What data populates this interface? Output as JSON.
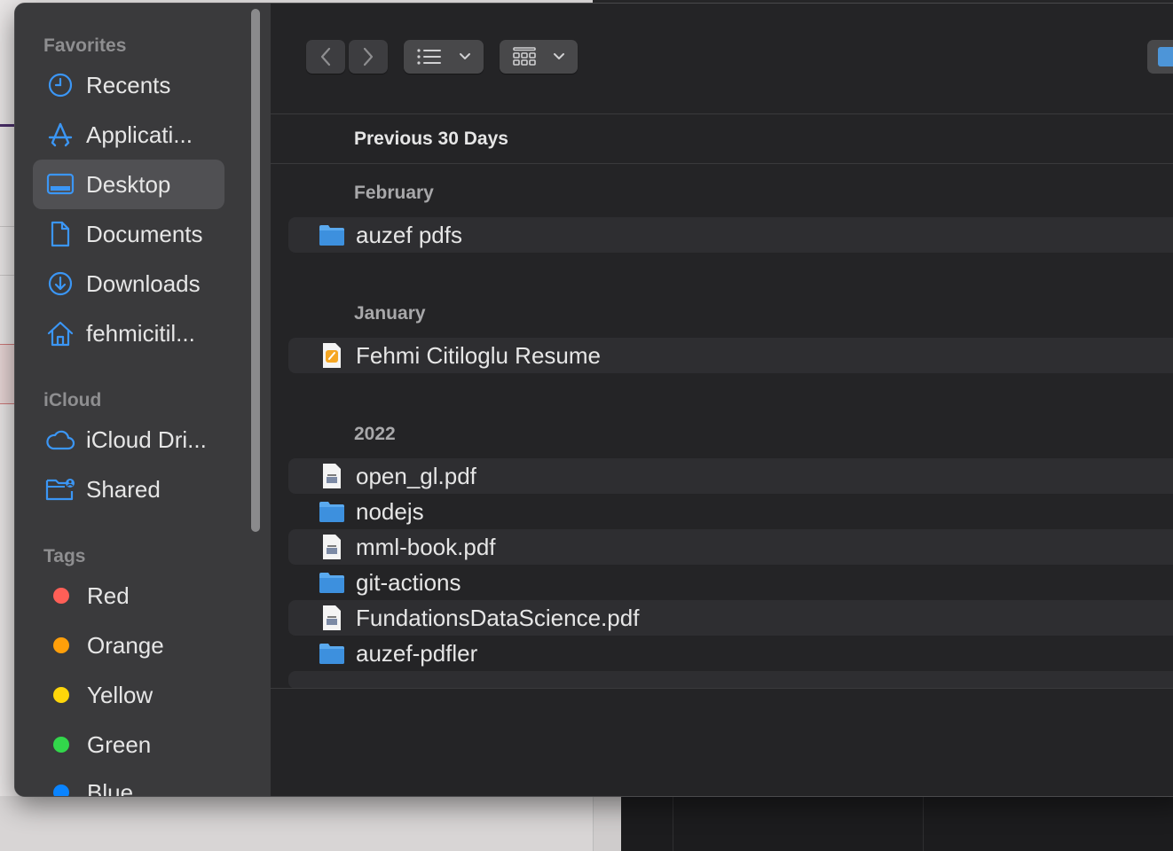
{
  "sidebar": {
    "favorites_title": "Favorites",
    "favorites": [
      {
        "label": "Recents",
        "icon": "clock-icon"
      },
      {
        "label": "Applicati...",
        "icon": "applications-icon"
      },
      {
        "label": "Desktop",
        "icon": "desktop-icon",
        "selected": true
      },
      {
        "label": "Documents",
        "icon": "document-icon"
      },
      {
        "label": "Downloads",
        "icon": "download-icon"
      },
      {
        "label": "fehmicitil...",
        "icon": "home-icon"
      }
    ],
    "icloud_title": "iCloud",
    "icloud": [
      {
        "label": "iCloud Dri...",
        "icon": "cloud-icon"
      },
      {
        "label": "Shared",
        "icon": "shared-folder-icon"
      }
    ],
    "tags_title": "Tags",
    "tags": [
      {
        "label": "Red",
        "color": "#ff5f57"
      },
      {
        "label": "Orange",
        "color": "#ff9f0a"
      },
      {
        "label": "Yellow",
        "color": "#ffd60a"
      },
      {
        "label": "Green",
        "color": "#32d74b"
      },
      {
        "label": "Blue",
        "color": "#0a84ff"
      }
    ]
  },
  "toolbar": {
    "back": "chevron-left-icon",
    "forward": "chevron-right-icon",
    "view": "list-view-icon",
    "group": "grid-group-icon"
  },
  "main": {
    "group_title": "Previous 30 Days",
    "sections": [
      {
        "title": "February",
        "items": [
          {
            "name": "auzef pdfs",
            "type": "folder"
          }
        ]
      },
      {
        "title": "January",
        "items": [
          {
            "name": "Fehmi Citiloglu Resume",
            "type": "pages"
          }
        ]
      },
      {
        "title": "2022",
        "items": [
          {
            "name": "open_gl.pdf",
            "type": "pdf"
          },
          {
            "name": "nodejs",
            "type": "folder"
          },
          {
            "name": "mml-book.pdf",
            "type": "pdf"
          },
          {
            "name": "git-actions",
            "type": "folder"
          },
          {
            "name": "FundationsDataScience.pdf",
            "type": "pdf"
          },
          {
            "name": "auzef-pdfler",
            "type": "folder"
          }
        ]
      }
    ]
  },
  "colors": {
    "accent": "#3b96f5",
    "folder": "#5aa9ee"
  }
}
